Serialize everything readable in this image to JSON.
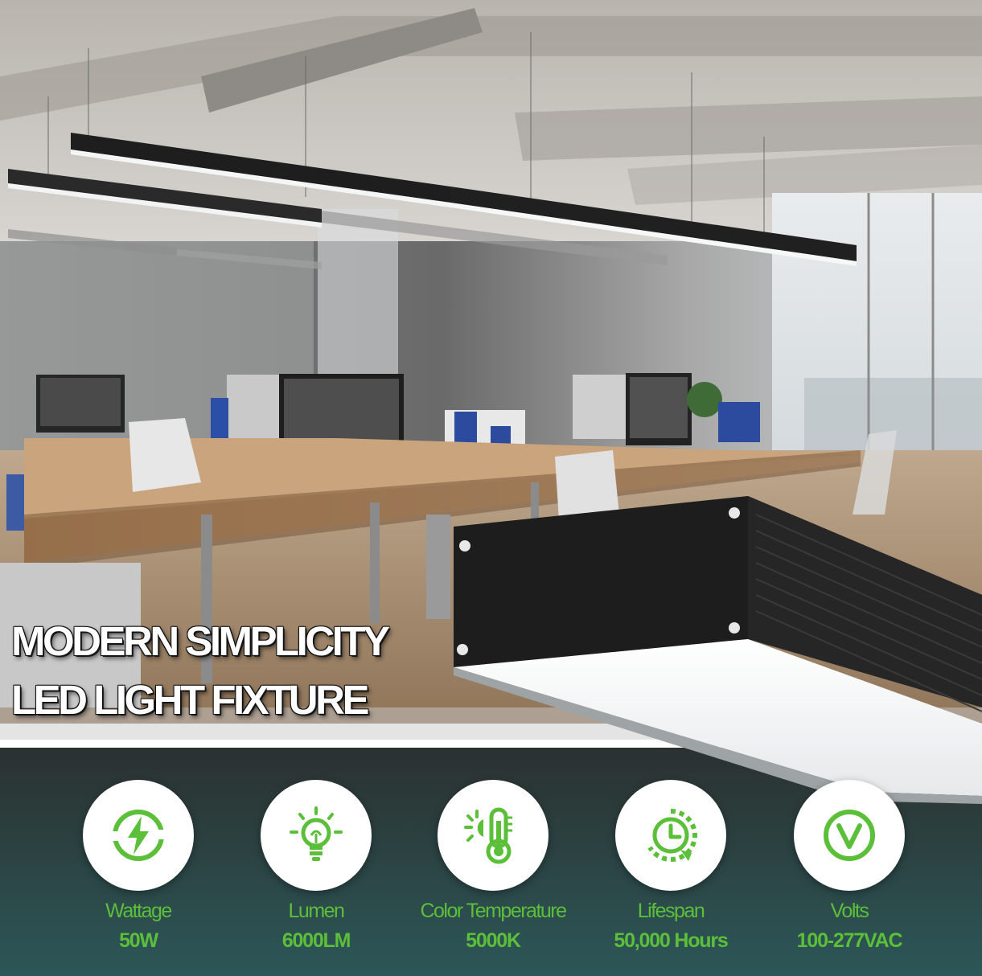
{
  "headline": {
    "line1": "MODERN SIMPLICITY",
    "line2": "LED LIGHT FIXTURE"
  },
  "colors": {
    "accent_green": "#5cbf3a",
    "panel_top": "#2b3130",
    "panel_bottom": "#2c5758",
    "fixture_black": "#1c1c1c"
  },
  "features": [
    {
      "icon": "lightning-bolt-icon",
      "label": "Wattage",
      "value": "50W"
    },
    {
      "icon": "light-bulb-icon",
      "label": "Lumen",
      "value": "6000LM"
    },
    {
      "icon": "thermometer-icon",
      "label": "Color Temperature",
      "value": "5000K"
    },
    {
      "icon": "clock-lifespan-icon",
      "label": "Lifespan",
      "value": "50,000 Hours"
    },
    {
      "icon": "voltage-v-icon",
      "label": "Volts",
      "value": "100-277VAC"
    }
  ]
}
